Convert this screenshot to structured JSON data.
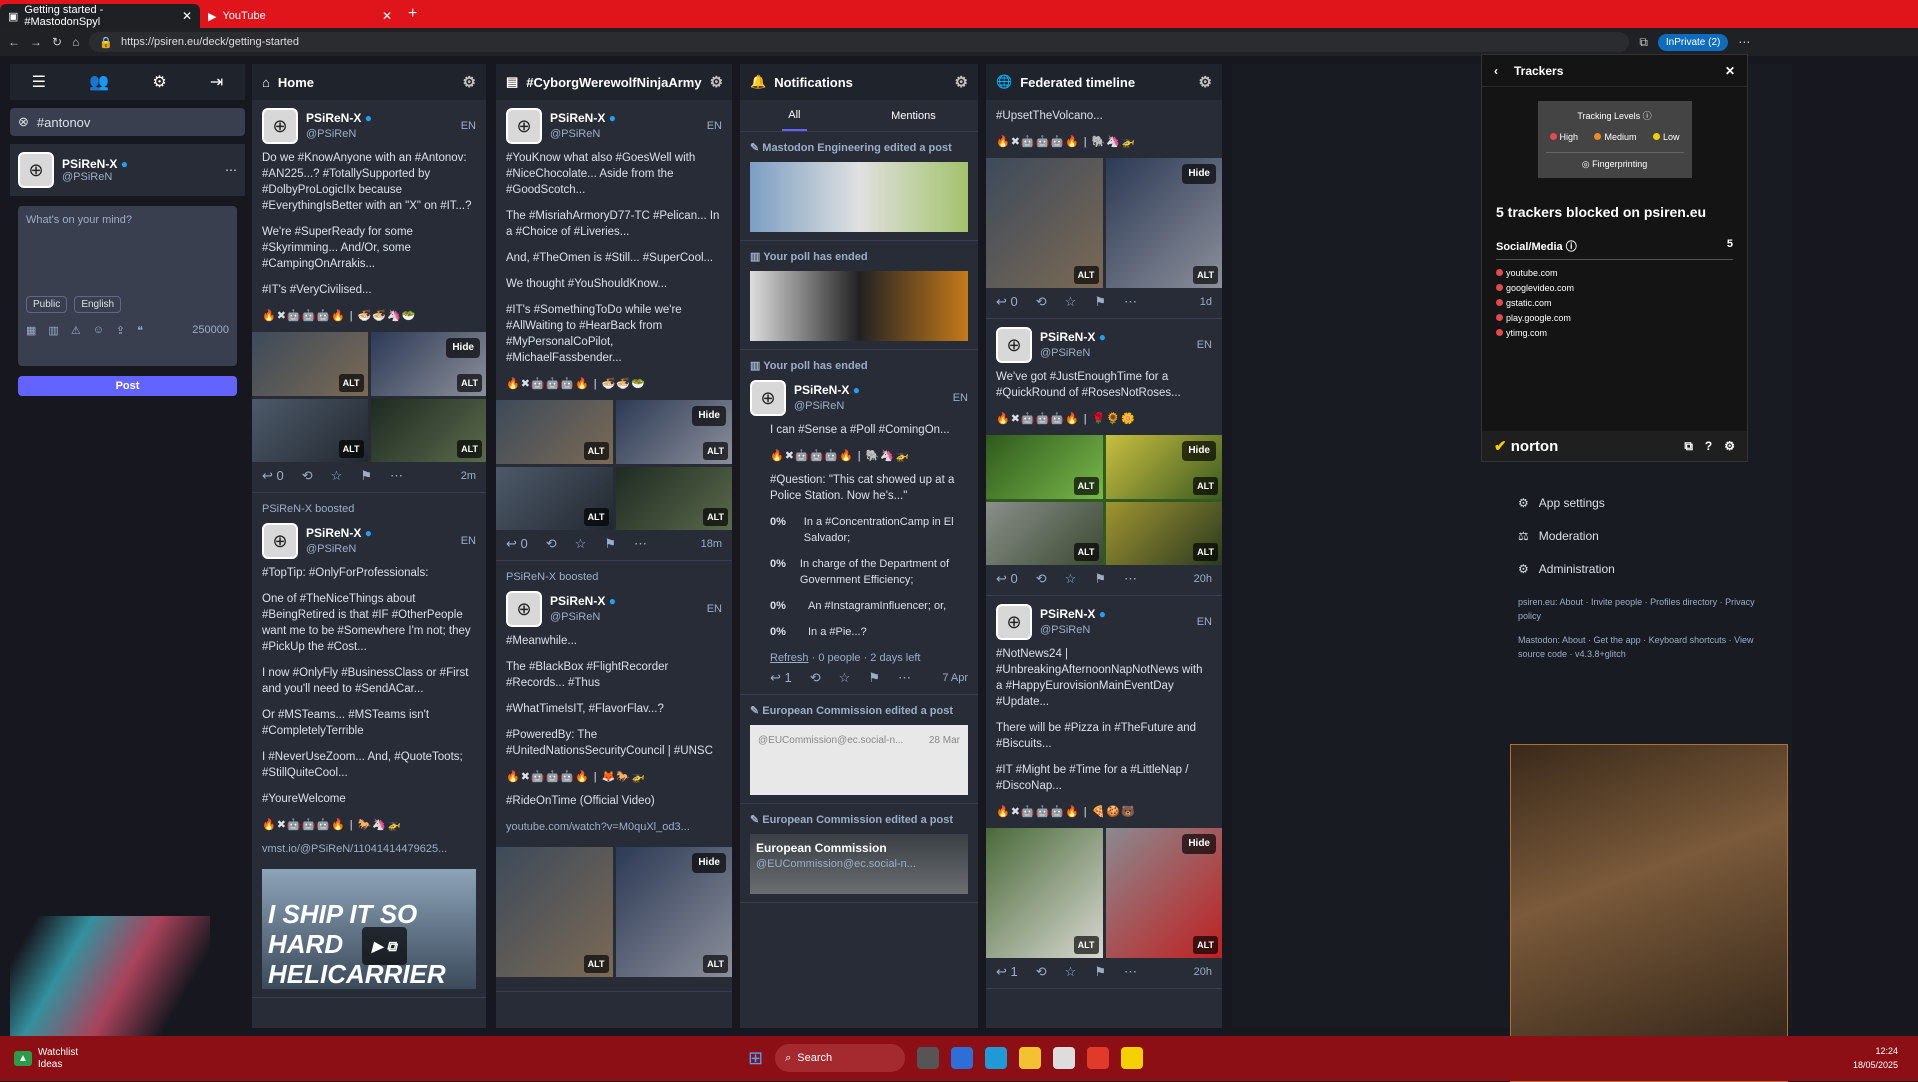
{
  "browser": {
    "tabs": [
      {
        "label": "Getting started - #MastodonSpyl"
      },
      {
        "label": "YouTube"
      }
    ],
    "url": "https://psiren.eu/deck/getting-started",
    "inprivate": "InPrivate (2)"
  },
  "compose": {
    "search_chip": "#antonov",
    "name": "PSiReN-X",
    "handle": "@PSiReN",
    "placeholder": "What's on your mind?",
    "visibility": "Public",
    "language": "English",
    "char_count": "250000",
    "post_label": "Post"
  },
  "columns": {
    "home": {
      "title": "Home",
      "post1": {
        "name": "PSiReN-X",
        "handle": "@PSiReN",
        "langs": "EN",
        "p1": "Do we #KnowAnyone with an #Antonov: #AN225...? #TotallySupported by #DolbyProLogicIIx because #EverythingIsBetter with an \"X\" on #IT...?",
        "p2": "We're #SuperReady for some #Skyrimming... And/Or, some #CampingOnArrakis...",
        "p3": "#IT's #VeryCivilised...",
        "hide": "Hide",
        "alt": "ALT",
        "reply_count": "0",
        "time": "2m"
      },
      "boost_label": "PSiReN-X boosted",
      "post2": {
        "name": "PSiReN-X",
        "handle": "@PSiReN",
        "langs": "EN",
        "p1": "#TopTip: #OnlyForProfessionals:",
        "p2": "One of #TheNiceThings about #BeingRetired is that #IF #OtherPeople want me to be #Somewhere I'm not; they #PickUp the #Cost...",
        "p3": "I now #OnlyFly #BusinessClass or #First and you'll need to #SendACar...",
        "p4": "Or #MSTeams... #MSTeams isn't #CompletelyTerrible",
        "p5": "I #NeverUseZoom... And, #QuoteToots; #StillQuiteCool...",
        "p6": "#YoureWelcome",
        "link": "vmst.io/@PSiReN/11041414479625...",
        "video_text": "I SHIP IT SO HARD HELICARRIER"
      }
    },
    "cyborg": {
      "title": "#CyborgWerewolfNinjaArmy",
      "post1": {
        "name": "PSiReN-X",
        "handle": "@PSiReN",
        "langs": "EN",
        "p1": "#YouKnow what also #GoesWell with #NiceChocolate... Aside from the #GoodScotch...",
        "p2": "The #MisriahArmoryD77-TC #Pelican... In a #Choice of #Liveries...",
        "p3": "And, #TheOmen is #Still... #SuperCool...",
        "p4": "We thought #YouShouldKnow...",
        "p5": "#IT's #SomethingToDo while we're #AllWaiting to #HearBack from #MyPersonalCoPilot, #MichaelFassbender...",
        "hide": "Hide",
        "reply_count": "0",
        "time": "18m"
      },
      "boost_label": "PSiReN-X boosted",
      "post2": {
        "name": "PSiReN-X",
        "handle": "@PSiReN",
        "langs": "EN",
        "p1": "#Meanwhile...",
        "p2": "The #BlackBox #FlightRecorder #Records... #Thus",
        "p3": "#WhatTimeIsIT, #FlavorFlav...?",
        "p4": "#PoweredBy: The #UnitedNationsSecurityCouncil | #UNSC",
        "p5": "#RideOnTime (Official Video)",
        "link": "youtube.com/watch?v=M0quXl_od3...",
        "hide": "Hide"
      }
    },
    "notifications": {
      "title": "Notifications",
      "tab_all": "All",
      "tab_mentions": "Mentions",
      "n1": "Mastodon Engineering edited a post",
      "n2": "Your poll has ended",
      "n3": "Your poll has ended",
      "poll_post": {
        "name": "PSiReN-X",
        "handle": "@PSiReN",
        "langs": "EN",
        "p1": "I can #Sense a #Poll #ComingOn...",
        "p2": "#Question: \"This cat showed up at a Police Station. Now he's...\"",
        "options": [
          {
            "pct": "0%",
            "text": "In a #ConcentrationCamp in El Salvador;"
          },
          {
            "pct": "0%",
            "text": "In charge of the Department of Government Efficiency;"
          },
          {
            "pct": "0%",
            "text": "An #InstagramInfluencer; or,"
          },
          {
            "pct": "0%",
            "text": "In a #Pie...?"
          }
        ],
        "refresh": "Refresh",
        "meta": "· 0 people · 2 days left",
        "reply_count": "1",
        "time": "7 Apr"
      },
      "n4": "European Commission edited a post",
      "n5": "European Commission edited a post",
      "ec_name": "European Commission",
      "ec_handle": "@EUCommission@ec.social-n...",
      "ec_time": "28 Mar"
    },
    "federated": {
      "title": "Federated timeline",
      "top": "#UpsetTheVolcano...",
      "post1": {
        "reply_count": "0",
        "time": "1d",
        "hide": "Hide"
      },
      "post2": {
        "name": "PSiReN-X",
        "handle": "@PSiReN",
        "langs": "EN",
        "p1": "We've got #JustEnoughTime for a #QuickRound of #RosesNotRoses...",
        "hide": "Hide",
        "reply_count": "0",
        "time": "20h"
      },
      "post3": {
        "name": "PSiReN-X",
        "handle": "@PSiReN",
        "langs": "EN",
        "p1": "#NotNews24 | #UnbreakingAfternoonNapNotNews with a #HappyEurovisionMainEventDay #Update...",
        "p2": "There will be #Pizza in #TheFuture and #Biscuits...",
        "p3": "#IT #Might be #Time for a #LittleNap / #DiscoNap...",
        "hide": "Hide",
        "reply_count": "1",
        "time": "20h"
      }
    }
  },
  "settings_menu": {
    "app_settings": "App settings",
    "moderation": "Moderation",
    "administration": "Administration",
    "footer1": "psiren.eu: About · Invite people · Profiles directory · Privacy policy",
    "footer2": "Mastodon: About · Get the app · Keyboard shortcuts · View source code · v4.3.8+glitch"
  },
  "trackers": {
    "title": "Trackers",
    "levels_title": "Tracking Levels",
    "high": "High",
    "medium": "Medium",
    "low": "Low",
    "fingerprinting": "Fingerprinting",
    "summary": "5 trackers blocked on psiren.eu",
    "category": "Social/Media",
    "category_count": "5",
    "domains": [
      "youtube.com",
      "googlevideo.com",
      "gstatic.com",
      "play.google.com",
      "ytimg.com"
    ],
    "brand": "norton"
  },
  "taskbar": {
    "watchlist": "Watchlist",
    "ideas": "Ideas",
    "search": "Search",
    "time": "12:24",
    "date": "18/05/2025"
  }
}
